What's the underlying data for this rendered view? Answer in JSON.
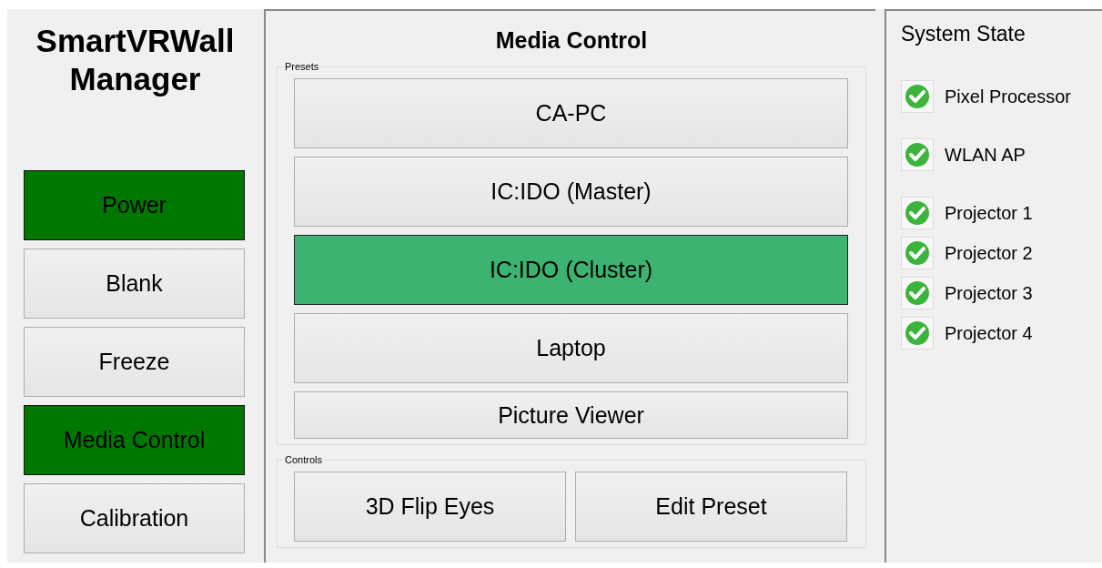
{
  "app_title": "SmartVRWall Manager",
  "sidebar": {
    "items": [
      {
        "label": "Power",
        "active": true
      },
      {
        "label": "Blank",
        "active": false
      },
      {
        "label": "Freeze",
        "active": false
      },
      {
        "label": "Media Control",
        "active": true
      },
      {
        "label": "Calibration",
        "active": false
      }
    ]
  },
  "media_control": {
    "title": "Media Control",
    "presets": {
      "label": "Presets",
      "items": [
        {
          "label": "CA-PC",
          "selected": false
        },
        {
          "label": "IC:IDO (Master)",
          "selected": false
        },
        {
          "label": "IC:IDO (Cluster)",
          "selected": true
        },
        {
          "label": "Laptop",
          "selected": false
        },
        {
          "label": "Picture Viewer",
          "selected": false
        }
      ]
    },
    "controls": {
      "label": "Controls",
      "buttons": [
        "3D Flip Eyes",
        "Edit Preset"
      ]
    }
  },
  "system_state": {
    "title": "System State",
    "items": [
      {
        "label": "Pixel Processor",
        "ok": true
      },
      {
        "label": "WLAN AP",
        "ok": true
      },
      {
        "label": "Projector 1",
        "ok": true
      },
      {
        "label": "Projector 2",
        "ok": true
      },
      {
        "label": "Projector 3",
        "ok": true
      },
      {
        "label": "Projector 4",
        "ok": true
      }
    ]
  }
}
